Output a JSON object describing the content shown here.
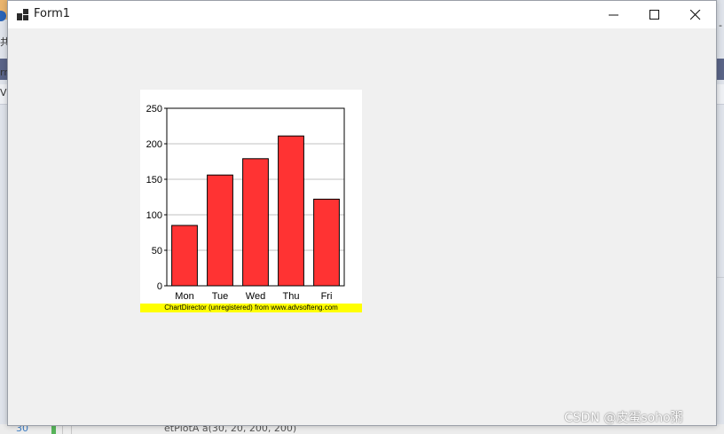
{
  "window": {
    "title": "Form1"
  },
  "chart_data": {
    "type": "bar",
    "categories": [
      "Mon",
      "Tue",
      "Wed",
      "Thu",
      "Fri"
    ],
    "values": [
      85,
      156,
      179,
      211,
      122
    ],
    "ylim": [
      0,
      250
    ],
    "yticks": [
      0,
      50,
      100,
      150,
      200,
      250
    ],
    "grid": true,
    "bar_color": "#ff3333",
    "title": "",
    "xlabel": "",
    "ylabel": ""
  },
  "chart_watermark": "ChartDirector (unregistered) from www.advsofteng.com",
  "page_watermark": "CSDN @皮蛋soho粥",
  "background": {
    "code_fragment": "etPlotA a(30, 20, 200, 200)",
    "line_number": "30"
  },
  "colors": {
    "window_bg": "#f0f0f0",
    "titlebar_bg": "#ffffff",
    "watermark_bg": "#ffff00"
  }
}
